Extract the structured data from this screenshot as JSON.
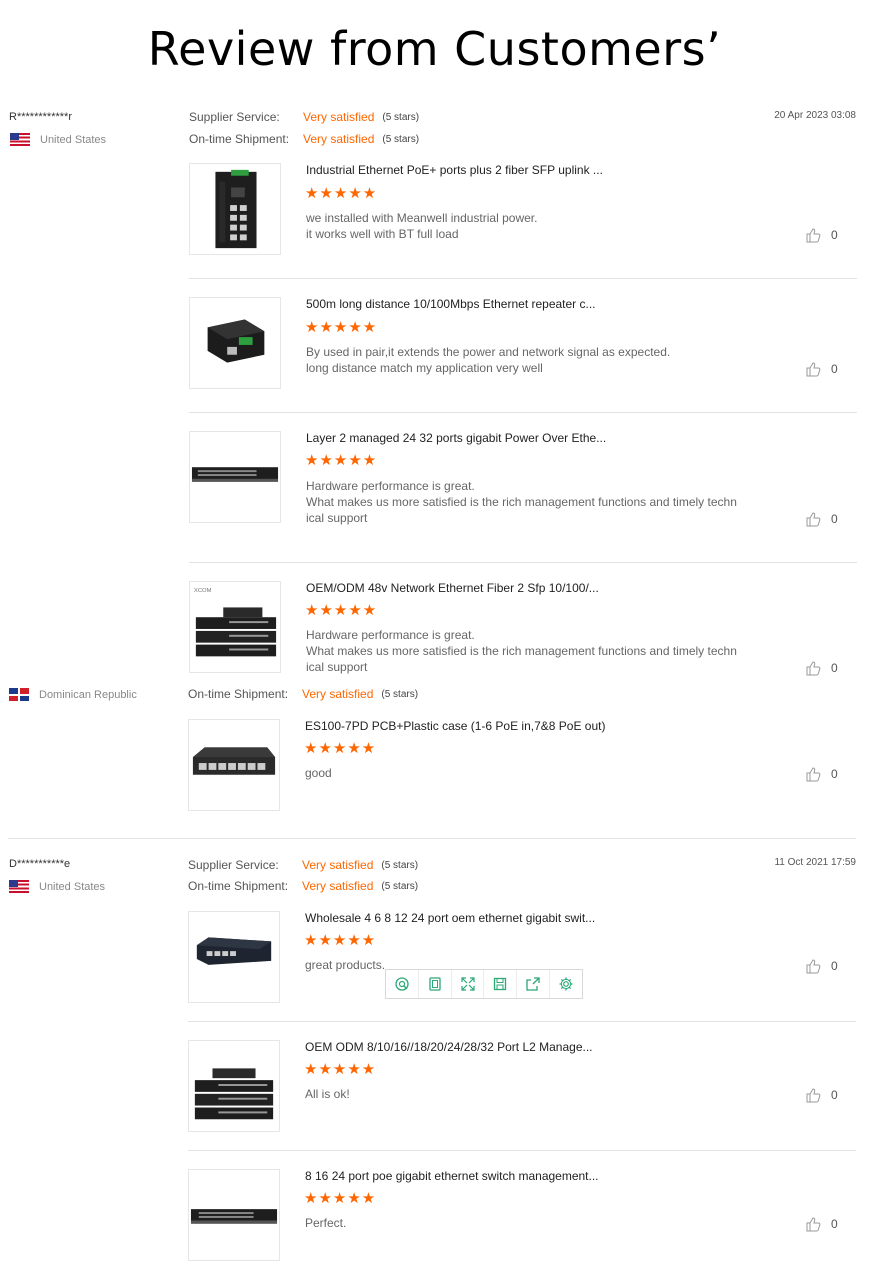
{
  "page_title": "Review from Customers’",
  "colors": {
    "accent": "#ff6600",
    "divider": "#e2e2e2",
    "toolbar_icon": "#2aa876"
  },
  "reviews": [
    {
      "name": "R************r",
      "country": "United States",
      "date": "20 Apr 2023 03:08",
      "ratings": [
        {
          "label": "Supplier Service:",
          "value": "Very satisfied",
          "stars": "(5 stars)"
        },
        {
          "label": "On-time Shipment:",
          "value": "Very satisfied",
          "stars": "(5 stars)"
        }
      ],
      "products": [
        {
          "title": "Industrial Ethernet PoE+ ports plus 2 fiber SFP uplink ...",
          "stars": 5,
          "comment": [
            "we installed with Meanwell industrial power.",
            "it works well with BT full load"
          ],
          "likes": "0",
          "image": "industrial-switch-icon"
        },
        {
          "title": "500m long distance 10/100Mbps Ethernet repeater c...",
          "stars": 5,
          "comment": [
            "By used in pair,it extends the power and network signal as expected.",
            "long distance match my application very well"
          ],
          "likes": "0",
          "image": "repeater-icon"
        },
        {
          "title": "Layer 2 managed 24 32 ports gigabit Power Over Ethe...",
          "stars": 5,
          "comment": [
            "Hardware performance is great.",
            "What makes us more satisfied is the rich management functions and timely techn",
            "ical support"
          ],
          "likes": "0",
          "image": "rack-switch-icon"
        },
        {
          "title": "OEM/ODM 48v Network Ethernet Fiber 2 Sfp 10/100/...",
          "stars": 5,
          "comment": [
            "Hardware performance is great.",
            "What makes us more satisfied is the rich management functions and timely techn",
            "ical support"
          ],
          "likes": "0",
          "image": "stacked-switches-icon",
          "brand": "XCOM"
        }
      ]
    },
    {
      "name": "",
      "country": "Dominican Republic",
      "date": "",
      "ratings": [
        {
          "label": "On-time Shipment:",
          "value": "Very satisfied",
          "stars": "(5 stars)"
        }
      ],
      "products": [
        {
          "title": "ES100-7PD PCB+Plastic case (1-6 PoE in,7&8 PoE out)",
          "stars": 5,
          "comment": [
            "good"
          ],
          "likes": "0",
          "image": "desktop-switch-icon"
        }
      ]
    },
    {
      "name": "D***********e",
      "country": "United States",
      "date": "11 Oct 2021 17:59",
      "ratings": [
        {
          "label": "Supplier Service:",
          "value": "Very satisfied",
          "stars": "(5 stars)"
        },
        {
          "label": "On-time Shipment:",
          "value": "Very satisfied",
          "stars": "(5 stars)"
        }
      ],
      "products": [
        {
          "title": "Wholesale 4 6 8 12 24 port oem ethernet gigabit swit...",
          "stars": 5,
          "comment": [
            "great products."
          ],
          "likes": "0",
          "image": "small-switch-icon"
        },
        {
          "title": "OEM ODM 8/10/16//18/20/24/28/32 Port L2 Manage...",
          "stars": 5,
          "comment": [
            "All is ok!"
          ],
          "likes": "0",
          "image": "stacked-switches-icon"
        },
        {
          "title": "8 16 24 port poe gigabit ethernet switch management...",
          "stars": 5,
          "comment": [
            "Perfect."
          ],
          "likes": "0",
          "image": "rack-switch-icon"
        }
      ]
    }
  ],
  "toolbar": [
    {
      "name": "search-icon"
    },
    {
      "name": "copy-icon"
    },
    {
      "name": "expand-icon"
    },
    {
      "name": "save-icon"
    },
    {
      "name": "share-icon"
    },
    {
      "name": "settings-icon"
    }
  ]
}
